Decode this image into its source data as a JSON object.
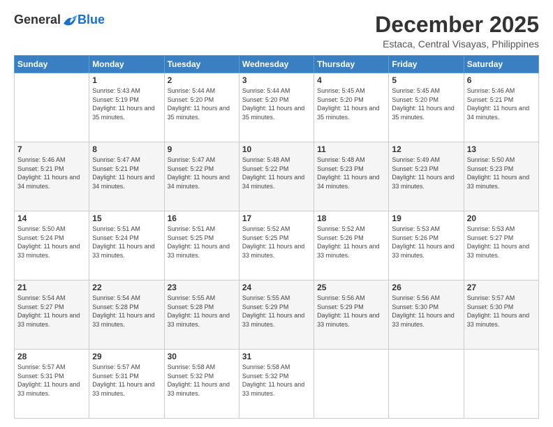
{
  "header": {
    "logo": {
      "general": "General",
      "blue": "Blue"
    },
    "title": "December 2025",
    "location": "Estaca, Central Visayas, Philippines"
  },
  "weekdays": [
    "Sunday",
    "Monday",
    "Tuesday",
    "Wednesday",
    "Thursday",
    "Friday",
    "Saturday"
  ],
  "weeks": [
    [
      {
        "day": null
      },
      {
        "day": "1",
        "sunrise": "Sunrise: 5:43 AM",
        "sunset": "Sunset: 5:19 PM",
        "daylight": "Daylight: 11 hours and 35 minutes."
      },
      {
        "day": "2",
        "sunrise": "Sunrise: 5:44 AM",
        "sunset": "Sunset: 5:20 PM",
        "daylight": "Daylight: 11 hours and 35 minutes."
      },
      {
        "day": "3",
        "sunrise": "Sunrise: 5:44 AM",
        "sunset": "Sunset: 5:20 PM",
        "daylight": "Daylight: 11 hours and 35 minutes."
      },
      {
        "day": "4",
        "sunrise": "Sunrise: 5:45 AM",
        "sunset": "Sunset: 5:20 PM",
        "daylight": "Daylight: 11 hours and 35 minutes."
      },
      {
        "day": "5",
        "sunrise": "Sunrise: 5:45 AM",
        "sunset": "Sunset: 5:20 PM",
        "daylight": "Daylight: 11 hours and 35 minutes."
      },
      {
        "day": "6",
        "sunrise": "Sunrise: 5:46 AM",
        "sunset": "Sunset: 5:21 PM",
        "daylight": "Daylight: 11 hours and 34 minutes."
      }
    ],
    [
      {
        "day": "7",
        "sunrise": "Sunrise: 5:46 AM",
        "sunset": "Sunset: 5:21 PM",
        "daylight": "Daylight: 11 hours and 34 minutes."
      },
      {
        "day": "8",
        "sunrise": "Sunrise: 5:47 AM",
        "sunset": "Sunset: 5:21 PM",
        "daylight": "Daylight: 11 hours and 34 minutes."
      },
      {
        "day": "9",
        "sunrise": "Sunrise: 5:47 AM",
        "sunset": "Sunset: 5:22 PM",
        "daylight": "Daylight: 11 hours and 34 minutes."
      },
      {
        "day": "10",
        "sunrise": "Sunrise: 5:48 AM",
        "sunset": "Sunset: 5:22 PM",
        "daylight": "Daylight: 11 hours and 34 minutes."
      },
      {
        "day": "11",
        "sunrise": "Sunrise: 5:48 AM",
        "sunset": "Sunset: 5:23 PM",
        "daylight": "Daylight: 11 hours and 34 minutes."
      },
      {
        "day": "12",
        "sunrise": "Sunrise: 5:49 AM",
        "sunset": "Sunset: 5:23 PM",
        "daylight": "Daylight: 11 hours and 33 minutes."
      },
      {
        "day": "13",
        "sunrise": "Sunrise: 5:50 AM",
        "sunset": "Sunset: 5:23 PM",
        "daylight": "Daylight: 11 hours and 33 minutes."
      }
    ],
    [
      {
        "day": "14",
        "sunrise": "Sunrise: 5:50 AM",
        "sunset": "Sunset: 5:24 PM",
        "daylight": "Daylight: 11 hours and 33 minutes."
      },
      {
        "day": "15",
        "sunrise": "Sunrise: 5:51 AM",
        "sunset": "Sunset: 5:24 PM",
        "daylight": "Daylight: 11 hours and 33 minutes."
      },
      {
        "day": "16",
        "sunrise": "Sunrise: 5:51 AM",
        "sunset": "Sunset: 5:25 PM",
        "daylight": "Daylight: 11 hours and 33 minutes."
      },
      {
        "day": "17",
        "sunrise": "Sunrise: 5:52 AM",
        "sunset": "Sunset: 5:25 PM",
        "daylight": "Daylight: 11 hours and 33 minutes."
      },
      {
        "day": "18",
        "sunrise": "Sunrise: 5:52 AM",
        "sunset": "Sunset: 5:26 PM",
        "daylight": "Daylight: 11 hours and 33 minutes."
      },
      {
        "day": "19",
        "sunrise": "Sunrise: 5:53 AM",
        "sunset": "Sunset: 5:26 PM",
        "daylight": "Daylight: 11 hours and 33 minutes."
      },
      {
        "day": "20",
        "sunrise": "Sunrise: 5:53 AM",
        "sunset": "Sunset: 5:27 PM",
        "daylight": "Daylight: 11 hours and 33 minutes."
      }
    ],
    [
      {
        "day": "21",
        "sunrise": "Sunrise: 5:54 AM",
        "sunset": "Sunset: 5:27 PM",
        "daylight": "Daylight: 11 hours and 33 minutes."
      },
      {
        "day": "22",
        "sunrise": "Sunrise: 5:54 AM",
        "sunset": "Sunset: 5:28 PM",
        "daylight": "Daylight: 11 hours and 33 minutes."
      },
      {
        "day": "23",
        "sunrise": "Sunrise: 5:55 AM",
        "sunset": "Sunset: 5:28 PM",
        "daylight": "Daylight: 11 hours and 33 minutes."
      },
      {
        "day": "24",
        "sunrise": "Sunrise: 5:55 AM",
        "sunset": "Sunset: 5:29 PM",
        "daylight": "Daylight: 11 hours and 33 minutes."
      },
      {
        "day": "25",
        "sunrise": "Sunrise: 5:56 AM",
        "sunset": "Sunset: 5:29 PM",
        "daylight": "Daylight: 11 hours and 33 minutes."
      },
      {
        "day": "26",
        "sunrise": "Sunrise: 5:56 AM",
        "sunset": "Sunset: 5:30 PM",
        "daylight": "Daylight: 11 hours and 33 minutes."
      },
      {
        "day": "27",
        "sunrise": "Sunrise: 5:57 AM",
        "sunset": "Sunset: 5:30 PM",
        "daylight": "Daylight: 11 hours and 33 minutes."
      }
    ],
    [
      {
        "day": "28",
        "sunrise": "Sunrise: 5:57 AM",
        "sunset": "Sunset: 5:31 PM",
        "daylight": "Daylight: 11 hours and 33 minutes."
      },
      {
        "day": "29",
        "sunrise": "Sunrise: 5:57 AM",
        "sunset": "Sunset: 5:31 PM",
        "daylight": "Daylight: 11 hours and 33 minutes."
      },
      {
        "day": "30",
        "sunrise": "Sunrise: 5:58 AM",
        "sunset": "Sunset: 5:32 PM",
        "daylight": "Daylight: 11 hours and 33 minutes."
      },
      {
        "day": "31",
        "sunrise": "Sunrise: 5:58 AM",
        "sunset": "Sunset: 5:32 PM",
        "daylight": "Daylight: 11 hours and 33 minutes."
      },
      {
        "day": null
      },
      {
        "day": null
      },
      {
        "day": null
      }
    ]
  ]
}
